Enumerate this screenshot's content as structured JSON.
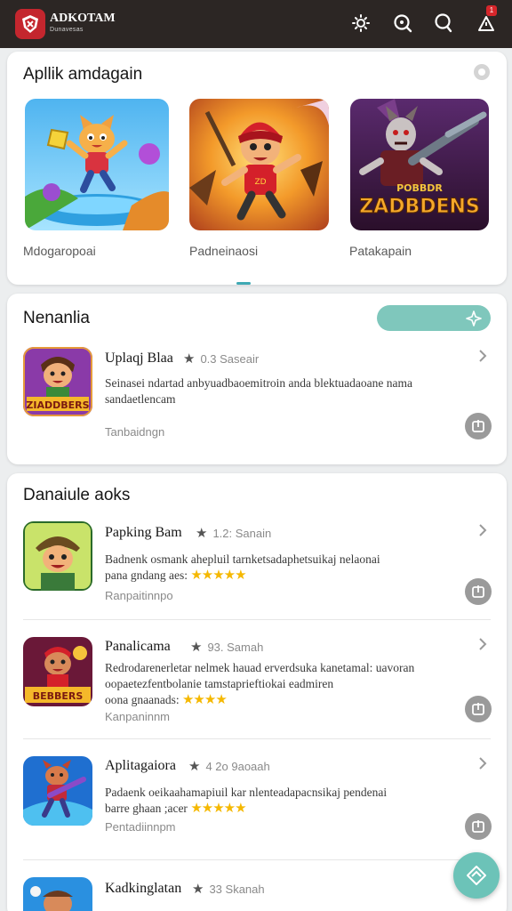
{
  "app": {
    "title": "ADKOTAM",
    "subtitle": "Dunavesas",
    "notification_count": "1"
  },
  "featured": {
    "title": "Apllik amdagain",
    "items": [
      {
        "label": "Mdogaropoai",
        "icon": "cat-hero-art"
      },
      {
        "label": "Padneinaosi",
        "icon": "red-hood-hero-art"
      },
      {
        "label": "Patakapain",
        "icon": "zombie-game-art",
        "art_text": [
          "POBBDR",
          "ZADBDENS"
        ]
      }
    ]
  },
  "new_section": {
    "title": "Nenanlia",
    "apps": [
      {
        "name": "Uplaqj Blaa",
        "rating": "0.3 Saseair",
        "description": "Seinasei ndartad anbyuadbaoemitroin anda blektuadaoane nama sandaetlencam",
        "subtext": "Tanbaidngn",
        "icon_text": "ZIADDBERS"
      }
    ]
  },
  "popular_section": {
    "title": "Danaiule aoks",
    "apps": [
      {
        "name": "Papking Bam",
        "rating": "1.2: Sanain",
        "description": "Badnenk osmank ahepluil tarnketsadaphetsuikaj nelaonai",
        "description2": "pana gndang aes:",
        "stars": "★★★★★",
        "subtext": "Ranpaitinnpo"
      },
      {
        "name": "Panalicama",
        "rating": "93. Samah",
        "description": "Redrodarenerletar nelmek hauad erverdsuka kanetamal: uavoran oopaetezfentbolanie tamstaprieftiokai eadmiren",
        "description2": "oona gnaanads:",
        "stars": "★★★★",
        "subtext": "Kanpaninnm",
        "icon_text": "BEBBERS"
      },
      {
        "name": "Aplitagaiora",
        "rating": "4 2o 9aoaah",
        "description": "Padaenk oeikaahamapiuil kar nlenteadapacnsikaj pendenai",
        "description2": "barre ghaan ;acer",
        "stars": "★★★★★",
        "subtext": "Pentadiinnpm"
      },
      {
        "name": "Kadkinglatan",
        "rating": "33 Skanah",
        "description": "",
        "description2": "",
        "stars": "",
        "subtext": ""
      }
    ]
  },
  "colors": {
    "top_bar": "#2c2624",
    "accent_teal": "#6cc3b8",
    "star_gold": "#f5b800",
    "logo_red": "#c4262e"
  }
}
